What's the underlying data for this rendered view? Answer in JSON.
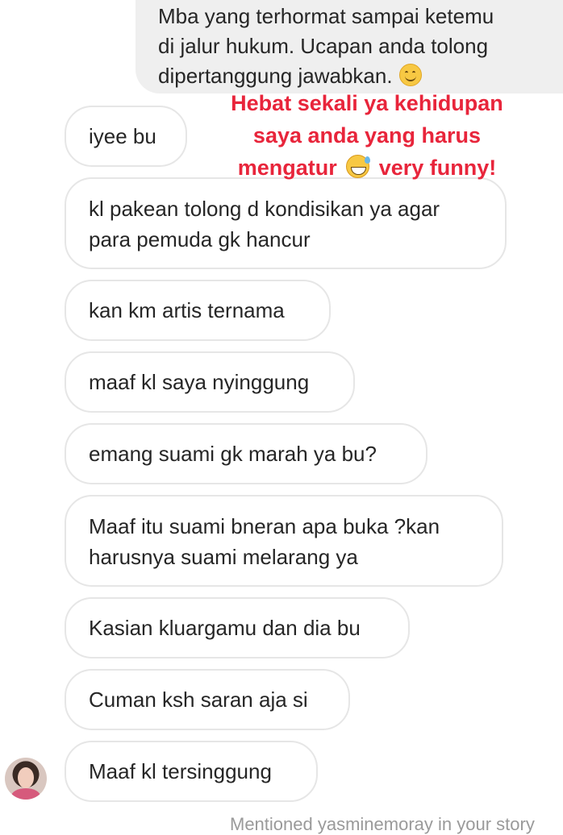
{
  "outgoing_message": {
    "lines": [
      "Mba yang terhormat sampai ketemu",
      "di jalur hukum. Ucapan anda tolong",
      "dipertanggung jawabkan."
    ],
    "emoji": "smiling-face-icon"
  },
  "overlay_caption": {
    "line1": "Hebat sekali ya kehidupan",
    "line2": "saya anda yang harus",
    "line3_before": "mengatur",
    "line3_after": "very funny!",
    "emoji": "grinning-sweat-icon",
    "color": "#e8253b"
  },
  "incoming_messages": [
    {
      "text": "iyee bu"
    },
    {
      "text": "kl pakean tolong d kondisikan ya agar para pemuda gk hancur"
    },
    {
      "text": "kan km artis ternama"
    },
    {
      "text": "maaf kl saya nyinggung"
    },
    {
      "text": "emang suami gk marah ya bu?"
    },
    {
      "text": "Maaf itu suami bneran apa buka ?kan harusnya suami melarang ya"
    },
    {
      "text": "Kasian kluargamu dan dia bu"
    },
    {
      "text": "Cuman ksh saran aja si"
    },
    {
      "text": "Maaf kl tersinggung"
    }
  ],
  "sender_avatar": "profile-avatar",
  "footer_note": "Mentioned yasminemoray in your story"
}
